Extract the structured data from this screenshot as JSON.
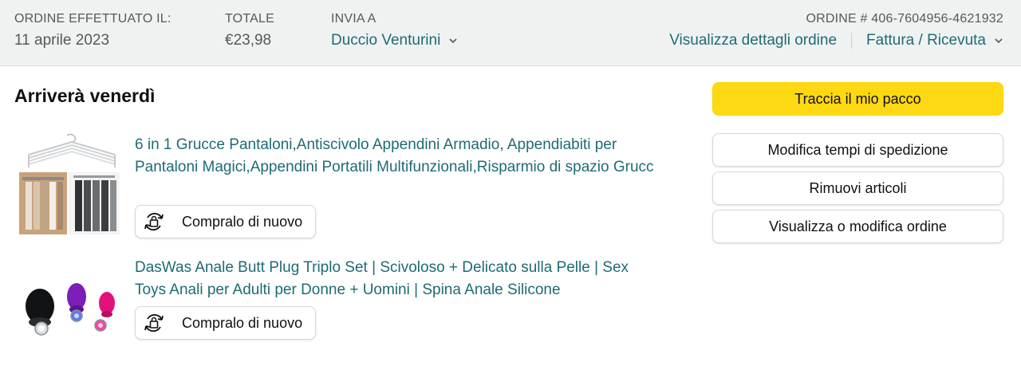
{
  "header": {
    "order_placed_label": "ORDINE EFFETTUATO IL:",
    "order_date": "11 aprile 2023",
    "total_label": "TOTALE",
    "total_value": "€23,98",
    "ship_to_label": "INVIA A",
    "ship_to_name": "Duccio Venturini",
    "order_number_label": "ORDINE # 406-7604956-4621932",
    "view_details_link": "Visualizza dettagli ordine",
    "invoice_link": "Fattura / Ricevuta"
  },
  "shipment": {
    "status": "Arriverà venerdì"
  },
  "items": [
    {
      "title": "6 in 1 Grucce Pantaloni,Antiscivolo Appendini Armadio, Appendiabiti per Pantaloni Magici,Appendini Portatili Multifunzionali,Risparmio di spazio Grucc",
      "buy_again_label": "Compralo di nuovo",
      "thumbnail_icon": "pants-hanger-product-image"
    },
    {
      "title": "DasWas Anale Butt Plug Triplo Set | Scivoloso + Delicato sulla Pelle | Sex Toys Anali per Adulti per Donne + Uomini | Spina Anale Silicone",
      "buy_again_label": "Compralo di nuovo",
      "thumbnail_icon": "three-piece-product-image"
    }
  ],
  "actions": {
    "track_package": "Traccia il mio pacco",
    "change_delivery": "Modifica tempi di spedizione",
    "remove_items": "Rimuovi articoli",
    "view_edit_order": "Visualizza o modifica ordine"
  },
  "colors": {
    "link": "#1e6b73",
    "primary_button": "#ffd814",
    "header_bg": "#f0f2f2"
  }
}
